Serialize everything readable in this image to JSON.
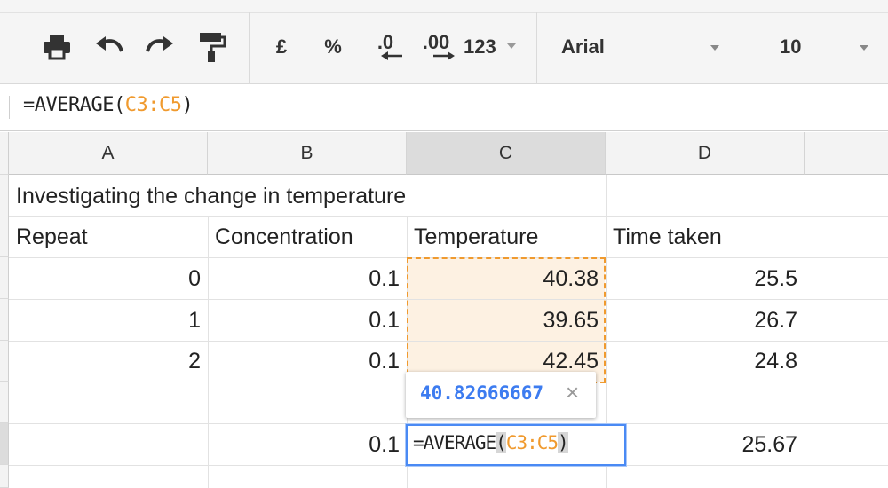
{
  "toolbar": {
    "currency_label": "£",
    "percent_label": "%",
    "decrease_decimals_label": ".0",
    "increase_decimals_label": ".00",
    "number_format_label": "123",
    "font_family": "Arial",
    "font_size": "10"
  },
  "formula_bar": {
    "prefix": "=AVERAGE(",
    "range": "C3:C5",
    "suffix": ")"
  },
  "columns": [
    "A",
    "B",
    "C",
    "D"
  ],
  "cells": {
    "title": "Investigating the change in temperature",
    "headers": [
      "Repeat",
      "Concentration",
      "Temperature",
      "Time taken"
    ],
    "rows": [
      [
        "0",
        "0.1",
        "40.38",
        "25.5"
      ],
      [
        "1",
        "0.1",
        "39.65",
        "26.7"
      ],
      [
        "2",
        "0.1",
        "42.45",
        "24.8"
      ]
    ],
    "summary": {
      "b": "0.1",
      "d": "25.67"
    }
  },
  "editor": {
    "prefix": "=AVERAGE",
    "open_paren": "(",
    "range": "C3:C5",
    "close_paren": ")"
  },
  "tooltip": {
    "value": "40.82666667",
    "close": "×"
  },
  "colors": {
    "range_reference": "#f09a2e",
    "active_border": "#4a8af4",
    "tooltip_value": "#3d7cf0"
  }
}
